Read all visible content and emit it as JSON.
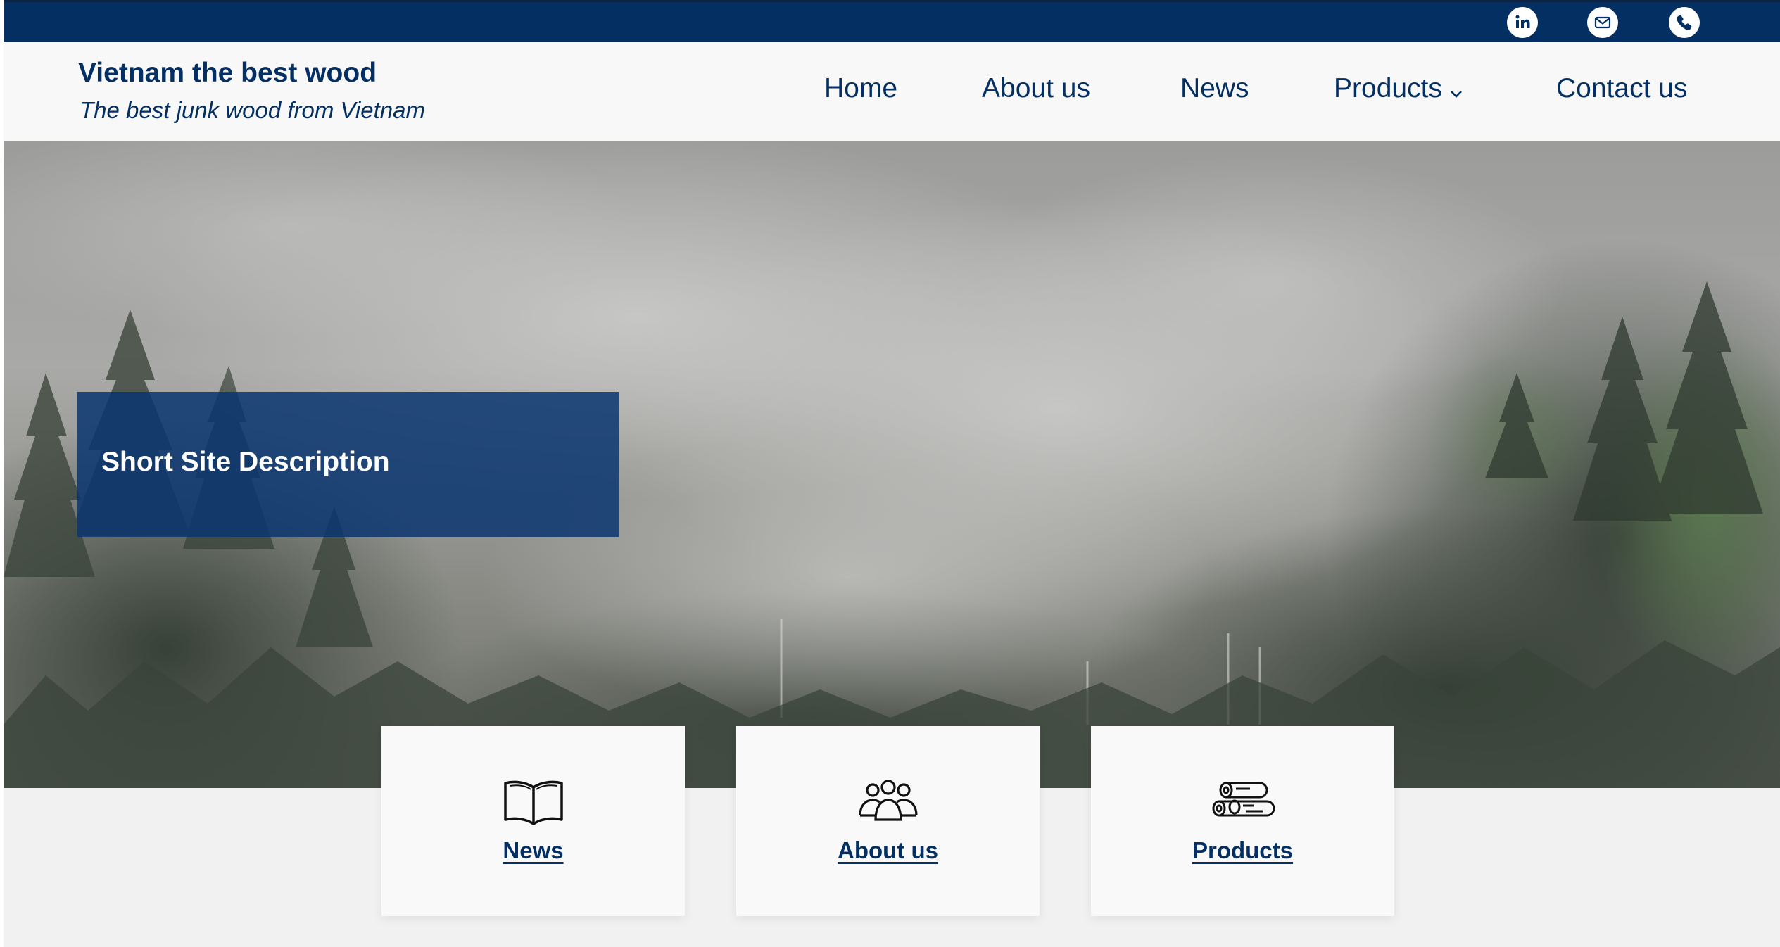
{
  "topbar": {
    "social": [
      {
        "name": "linkedin-icon",
        "glyph": "in"
      },
      {
        "name": "mail-icon"
      },
      {
        "name": "phone-icon"
      }
    ]
  },
  "header": {
    "site_title": "Vietnam the best wood",
    "tagline": "The best junk wood from Vietnam",
    "nav": {
      "home": "Home",
      "about": "About us",
      "news": "News",
      "products": "Products",
      "contact": "Contact us"
    }
  },
  "hero": {
    "description": "Short Site Description"
  },
  "cards": {
    "news": {
      "label": "News",
      "icon": "open-book-icon"
    },
    "about": {
      "label": "About us",
      "icon": "people-group-icon"
    },
    "products": {
      "label": "Products",
      "icon": "wood-logs-icon"
    }
  },
  "colors": {
    "brand": "#042f63",
    "page_background": "#f1f1f1",
    "header_background": "#f8f8f8"
  }
}
